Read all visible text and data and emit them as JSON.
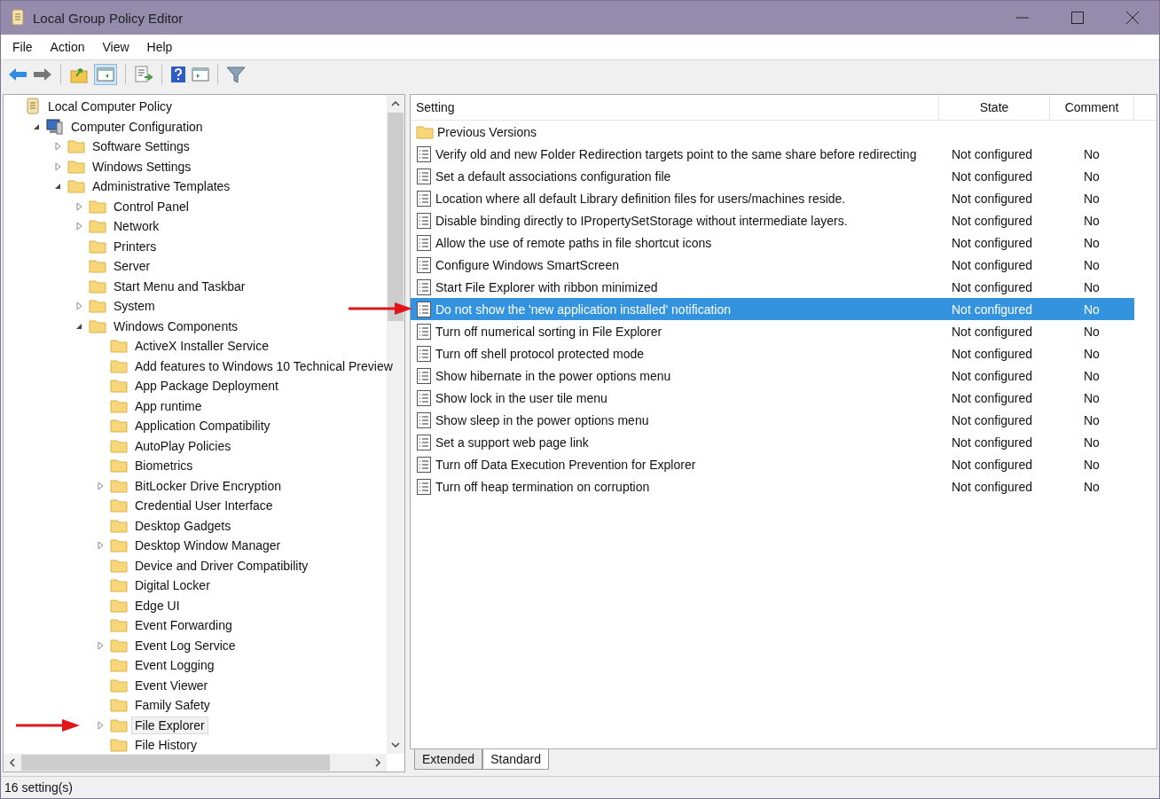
{
  "window": {
    "title": "Local Group Policy Editor"
  },
  "menu": [
    "File",
    "Action",
    "View",
    "Help"
  ],
  "tree": [
    {
      "label": "Local Computer Policy",
      "kind": "policy",
      "selected": false,
      "children": [
        {
          "label": "Computer Configuration",
          "kind": "computer",
          "expanded": true,
          "selected": false,
          "children": [
            {
              "label": "Software Settings",
              "kind": "folder",
              "expanded": false,
              "selected": false
            },
            {
              "label": "Windows Settings",
              "kind": "folder",
              "expanded": false,
              "selected": false
            },
            {
              "label": "Administrative Templates",
              "kind": "folder",
              "expanded": true,
              "selected": false,
              "children": [
                {
                  "label": "Control Panel",
                  "kind": "folder",
                  "expanded": false,
                  "selected": false
                },
                {
                  "label": "Network",
                  "kind": "folder",
                  "expanded": false,
                  "selected": false
                },
                {
                  "label": "Printers",
                  "kind": "folder",
                  "selected": false
                },
                {
                  "label": "Server",
                  "kind": "folder",
                  "selected": false
                },
                {
                  "label": "Start Menu and Taskbar",
                  "kind": "folder",
                  "selected": false
                },
                {
                  "label": "System",
                  "kind": "folder",
                  "expanded": false,
                  "selected": false
                },
                {
                  "label": "Windows Components",
                  "kind": "folder",
                  "expanded": true,
                  "selected": false,
                  "children": [
                    {
                      "label": "ActiveX Installer Service",
                      "kind": "folder",
                      "selected": false
                    },
                    {
                      "label": "Add features to Windows 10 Technical Preview",
                      "kind": "folder",
                      "selected": false
                    },
                    {
                      "label": "App Package Deployment",
                      "kind": "folder",
                      "selected": false
                    },
                    {
                      "label": "App runtime",
                      "kind": "folder",
                      "selected": false
                    },
                    {
                      "label": "Application Compatibility",
                      "kind": "folder",
                      "selected": false
                    },
                    {
                      "label": "AutoPlay Policies",
                      "kind": "folder",
                      "selected": false
                    },
                    {
                      "label": "Biometrics",
                      "kind": "folder",
                      "selected": false
                    },
                    {
                      "label": "BitLocker Drive Encryption",
                      "kind": "folder",
                      "expanded": false,
                      "selected": false
                    },
                    {
                      "label": "Credential User Interface",
                      "kind": "folder",
                      "selected": false
                    },
                    {
                      "label": "Desktop Gadgets",
                      "kind": "folder",
                      "selected": false
                    },
                    {
                      "label": "Desktop Window Manager",
                      "kind": "folder",
                      "expanded": false,
                      "selected": false
                    },
                    {
                      "label": "Device and Driver Compatibility",
                      "kind": "folder",
                      "selected": false
                    },
                    {
                      "label": "Digital Locker",
                      "kind": "folder",
                      "selected": false
                    },
                    {
                      "label": "Edge UI",
                      "kind": "folder",
                      "selected": false
                    },
                    {
                      "label": "Event Forwarding",
                      "kind": "folder",
                      "selected": false
                    },
                    {
                      "label": "Event Log Service",
                      "kind": "folder",
                      "expanded": false,
                      "selected": false
                    },
                    {
                      "label": "Event Logging",
                      "kind": "folder",
                      "selected": false
                    },
                    {
                      "label": "Event Viewer",
                      "kind": "folder",
                      "selected": false
                    },
                    {
                      "label": "Family Safety",
                      "kind": "folder",
                      "selected": false
                    },
                    {
                      "label": "File Explorer",
                      "kind": "folder",
                      "expanded": false,
                      "selected": true
                    },
                    {
                      "label": "File History",
                      "kind": "folder",
                      "selected": false
                    }
                  ]
                }
              ]
            }
          ]
        }
      ]
    }
  ],
  "table": {
    "columns": [
      "Setting",
      "State",
      "Comment"
    ],
    "rows": [
      {
        "kind": "folder",
        "setting": "Previous Versions",
        "selected": false
      },
      {
        "kind": "setting",
        "setting": "Verify old and new Folder Redirection targets point to the same share before redirecting",
        "state": "Not configured",
        "comment": "No",
        "selected": false
      },
      {
        "kind": "setting",
        "setting": "Set a default associations configuration file",
        "state": "Not configured",
        "comment": "No",
        "selected": false
      },
      {
        "kind": "setting",
        "setting": "Location where all default Library definition files for users/machines reside.",
        "state": "Not configured",
        "comment": "No",
        "selected": false
      },
      {
        "kind": "setting",
        "setting": "Disable binding directly to IPropertySetStorage without intermediate layers.",
        "state": "Not configured",
        "comment": "No",
        "selected": false
      },
      {
        "kind": "setting",
        "setting": "Allow the use of remote paths in file shortcut icons",
        "state": "Not configured",
        "comment": "No",
        "selected": false
      },
      {
        "kind": "setting",
        "setting": "Configure Windows SmartScreen",
        "state": "Not configured",
        "comment": "No",
        "selected": false
      },
      {
        "kind": "setting",
        "setting": "Start File Explorer with ribbon minimized",
        "state": "Not configured",
        "comment": "No",
        "selected": false
      },
      {
        "kind": "setting",
        "setting": "Do not show the 'new application installed' notification",
        "state": "Not configured",
        "comment": "No",
        "selected": true
      },
      {
        "kind": "setting",
        "setting": "Turn off numerical sorting in File Explorer",
        "state": "Not configured",
        "comment": "No",
        "selected": false
      },
      {
        "kind": "setting",
        "setting": "Turn off shell protocol protected mode",
        "state": "Not configured",
        "comment": "No",
        "selected": false
      },
      {
        "kind": "setting",
        "setting": "Show hibernate in the power options menu",
        "state": "Not configured",
        "comment": "No",
        "selected": false
      },
      {
        "kind": "setting",
        "setting": "Show lock in the user tile menu",
        "state": "Not configured",
        "comment": "No",
        "selected": false
      },
      {
        "kind": "setting",
        "setting": "Show sleep in the power options menu",
        "state": "Not configured",
        "comment": "No",
        "selected": false
      },
      {
        "kind": "setting",
        "setting": "Set a support web page link",
        "state": "Not configured",
        "comment": "No",
        "selected": false
      },
      {
        "kind": "setting",
        "setting": "Turn off Data Execution Prevention for Explorer",
        "state": "Not configured",
        "comment": "No",
        "selected": false
      },
      {
        "kind": "setting",
        "setting": "Turn off heap termination on corruption",
        "state": "Not configured",
        "comment": "No",
        "selected": false
      }
    ]
  },
  "tabs": [
    {
      "label": "Extended",
      "selected": false
    },
    {
      "label": "Standard",
      "selected": true
    }
  ],
  "status_bar": "16 setting(s)"
}
